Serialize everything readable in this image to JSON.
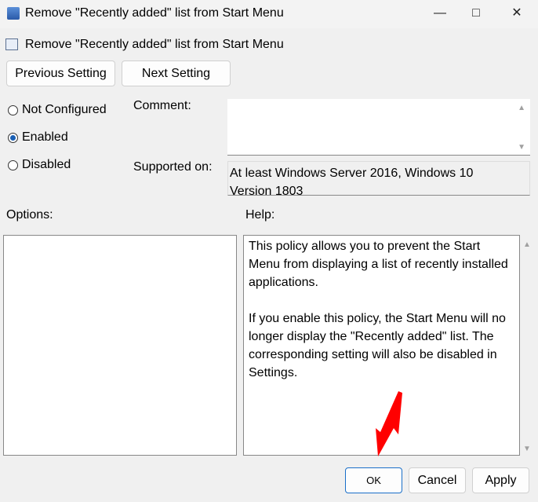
{
  "window": {
    "title": "Remove \"Recently added\" list from Start Menu",
    "icon": "policy-icon"
  },
  "header": {
    "policy_name": "Remove \"Recently added\" list from Start Menu",
    "icon": "setting-icon"
  },
  "nav": {
    "previous": "Previous Setting",
    "next": "Next Setting"
  },
  "state": {
    "options": [
      "Not Configured",
      "Enabled",
      "Disabled"
    ],
    "selected": "Enabled"
  },
  "labels": {
    "comment": "Comment:",
    "supported_on": "Supported on:",
    "options": "Options:",
    "help": "Help:"
  },
  "comment": {
    "value": ""
  },
  "supported_on": "At least Windows Server 2016, Windows 10 Version 1803",
  "help": [
    "This policy allows you to prevent the Start Menu from displaying a list of recently installed applications.",
    "If you enable this policy, the Start Menu will no longer display the \"Recently added\" list. The corresponding setting will also be disabled in Settings."
  ],
  "buttons": {
    "ok": "OK",
    "cancel": "Cancel",
    "apply": "Apply"
  },
  "annotation": {
    "arrow_color": "#ff0000"
  }
}
